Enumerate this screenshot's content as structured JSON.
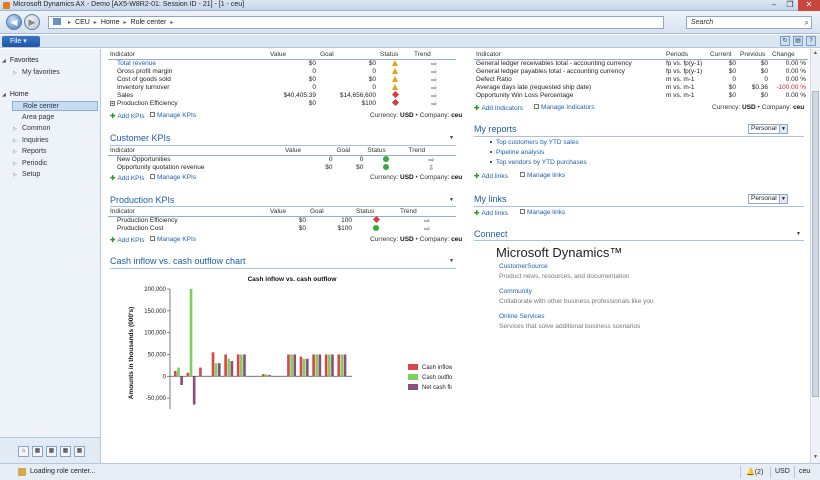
{
  "window": {
    "title": "Microsoft Dynamics AX - Demo [AX5-W8R2-01: Session ID - 21] - [1 - ceu]",
    "controls": [
      "–",
      "❐",
      "✕"
    ]
  },
  "address": {
    "path": [
      "CEU",
      "Home",
      "Role center"
    ],
    "search_placeholder": "Search"
  },
  "menu": {
    "file_label": "File"
  },
  "sidebar": {
    "favorites_label": "Favorites",
    "favorites_items": [
      "My favorites"
    ],
    "home_label": "Home",
    "home_items": [
      {
        "label": "Role center",
        "selected": true,
        "expandable": false
      },
      {
        "label": "Area page",
        "selected": false,
        "expandable": false
      },
      {
        "label": "Common",
        "selected": false,
        "expandable": true
      },
      {
        "label": "Inquiries",
        "selected": false,
        "expandable": true
      },
      {
        "label": "Reports",
        "selected": false,
        "expandable": true
      },
      {
        "label": "Periodic",
        "selected": false,
        "expandable": true
      },
      {
        "label": "Setup",
        "selected": false,
        "expandable": true
      }
    ]
  },
  "financial_kpis": {
    "headers": [
      "Indicator",
      "Value",
      "Goal",
      "Status",
      "Trend"
    ],
    "rows": [
      {
        "indicator": "Total revenue",
        "value": "$0",
        "goal": "$0",
        "status": "warning",
        "trend": "right",
        "link": true,
        "expand": false
      },
      {
        "indicator": "Gross profit margin",
        "value": "0",
        "goal": "0",
        "status": "warning",
        "trend": "right",
        "link": false,
        "expand": false
      },
      {
        "indicator": "Cost of goods sold",
        "value": "$0",
        "goal": "$0",
        "status": "warning",
        "trend": "right",
        "link": false,
        "expand": false
      },
      {
        "indicator": "Inventory turnover",
        "value": "0",
        "goal": "0",
        "status": "warning",
        "trend": "right",
        "link": false,
        "expand": false
      },
      {
        "indicator": "Sales",
        "value": "$40,405.39",
        "goal": "$14,656,600",
        "status": "bad",
        "trend": "right",
        "link": false,
        "expand": false
      },
      {
        "indicator": "Production Efficiency",
        "value": "$0",
        "goal": "$100",
        "status": "bad",
        "trend": "right",
        "link": false,
        "expand": true
      }
    ],
    "add_label": "Add KPIs",
    "manage_label": "Manage KPIs",
    "currency_label": "Currency:",
    "currency_value": "USD",
    "company_label": "Company:",
    "company_value": "ceu"
  },
  "customer_kpis": {
    "title": "Customer KPIs",
    "headers": [
      "Indicator",
      "Value",
      "Goal",
      "Status",
      "Trend"
    ],
    "rows": [
      {
        "indicator": "New Opportunities",
        "value": "0",
        "goal": "0",
        "status": "good",
        "trend": "right"
      },
      {
        "indicator": "Opportunity quotation revenue",
        "value": "$0",
        "goal": "$0",
        "status": "good",
        "trend": "down"
      }
    ],
    "add_label": "Add KPIs",
    "manage_label": "Manage KPIs",
    "currency_label": "Currency:",
    "currency_value": "USD",
    "company_label": "Company:",
    "company_value": "ceu"
  },
  "production_kpis": {
    "title": "Production KPIs",
    "headers": [
      "Indicator",
      "Value",
      "Goal",
      "Status",
      "Trend"
    ],
    "rows": [
      {
        "indicator": "Production Efficiency",
        "value": "$0",
        "goal": "100",
        "status": "bad",
        "trend": "right"
      },
      {
        "indicator": "Production Cost",
        "value": "$0",
        "goal": "$100",
        "status": "good",
        "trend": "right"
      }
    ],
    "add_label": "Add KPIs",
    "manage_label": "Manage KPIs",
    "currency_label": "Currency:",
    "currency_value": "USD",
    "company_label": "Company:",
    "company_value": "ceu"
  },
  "cash_chart_part": {
    "title": "Cash inflow vs. cash outflow chart"
  },
  "chart_data": {
    "type": "bar",
    "title": "Cash inflow vs. cash outflow",
    "ylabel": "Amounts in thousands (000's)",
    "xlabel": "",
    "ylim": [
      -75000,
      200000
    ],
    "yticks": [
      "200,000",
      "150,000",
      "100,000",
      "50,000",
      "0",
      "-50,000"
    ],
    "ytick_values": [
      200000,
      150000,
      100000,
      50000,
      0,
      -50000
    ],
    "groups": 14,
    "series": [
      {
        "name": "Cash inflow",
        "color": "#d94848",
        "values": [
          12000,
          8000,
          20000,
          55000,
          50000,
          50000,
          0,
          5000,
          0,
          50000,
          45000,
          50000,
          50000,
          50000
        ]
      },
      {
        "name": "Cash outflow",
        "color": "#7fd05a",
        "values": [
          20000,
          200000,
          0,
          30000,
          40000,
          50000,
          0,
          4000,
          0,
          50000,
          40000,
          50000,
          50000,
          50000
        ]
      },
      {
        "name": "Net cash flow",
        "color": "#8a4f7c",
        "values": [
          -20000,
          -65000,
          0,
          30000,
          35000,
          50000,
          0,
          3000,
          0,
          50000,
          40000,
          50000,
          50000,
          50000
        ]
      }
    ],
    "legend_position": "right"
  },
  "kpi_right": {
    "headers": [
      "Indicator",
      "Periods",
      "Current",
      "Previous",
      "Change"
    ],
    "rows": [
      {
        "indicator": "General ledger receivables total - accounting currency",
        "periods": "fp vs. fp(y-1)",
        "current": "$0",
        "previous": "$0",
        "change": "0.00 %",
        "neg": false
      },
      {
        "indicator": "General ledger payables total - accounting currency",
        "periods": "fp vs. fp(y-1)",
        "current": "$0",
        "previous": "$0",
        "change": "0.00 %",
        "neg": false
      },
      {
        "indicator": "Defect Ratio",
        "periods": "m vs. m-1",
        "current": "0",
        "previous": "0",
        "change": "0.00 %",
        "neg": false
      },
      {
        "indicator": "Average days late (requested ship date)",
        "periods": "m vs. m-1",
        "current": "$0",
        "previous": "$0.36",
        "change": "-100.00 %",
        "neg": true
      },
      {
        "indicator": "Opportunity Win Loss Percentage",
        "periods": "m vs. m-1",
        "current": "$0",
        "previous": "$0",
        "change": "0.00 %",
        "neg": false
      }
    ],
    "add_label": "Add Indicators",
    "manage_label": "Manage Indicators",
    "currency_label": "Currency:",
    "currency_value": "USD",
    "company_label": "Company:",
    "company_value": "ceu"
  },
  "my_reports": {
    "title": "My reports",
    "view_value": "Personal",
    "links": [
      "Top customers by YTD sales",
      "Pipeline analysis",
      "Top vendors by YTD purchases"
    ],
    "add_label": "Add links",
    "manage_label": "Manage links"
  },
  "my_links": {
    "title": "My links",
    "view_value": "Personal",
    "add_label": "Add links",
    "manage_label": "Manage links"
  },
  "connect": {
    "title": "Connect",
    "brand": "Microsoft Dynamics™",
    "items": [
      {
        "link": "CustomerSource",
        "desc": "Product news, resources, and documentation"
      },
      {
        "link": "Community",
        "desc": "Collaborate with other business professionals like you"
      },
      {
        "link": "Online Services",
        "desc": "Services that solve additional business scenarios"
      }
    ]
  },
  "status": {
    "text": "Loading role center...",
    "notifications": "(2)",
    "currency": "USD",
    "company": "ceu"
  }
}
